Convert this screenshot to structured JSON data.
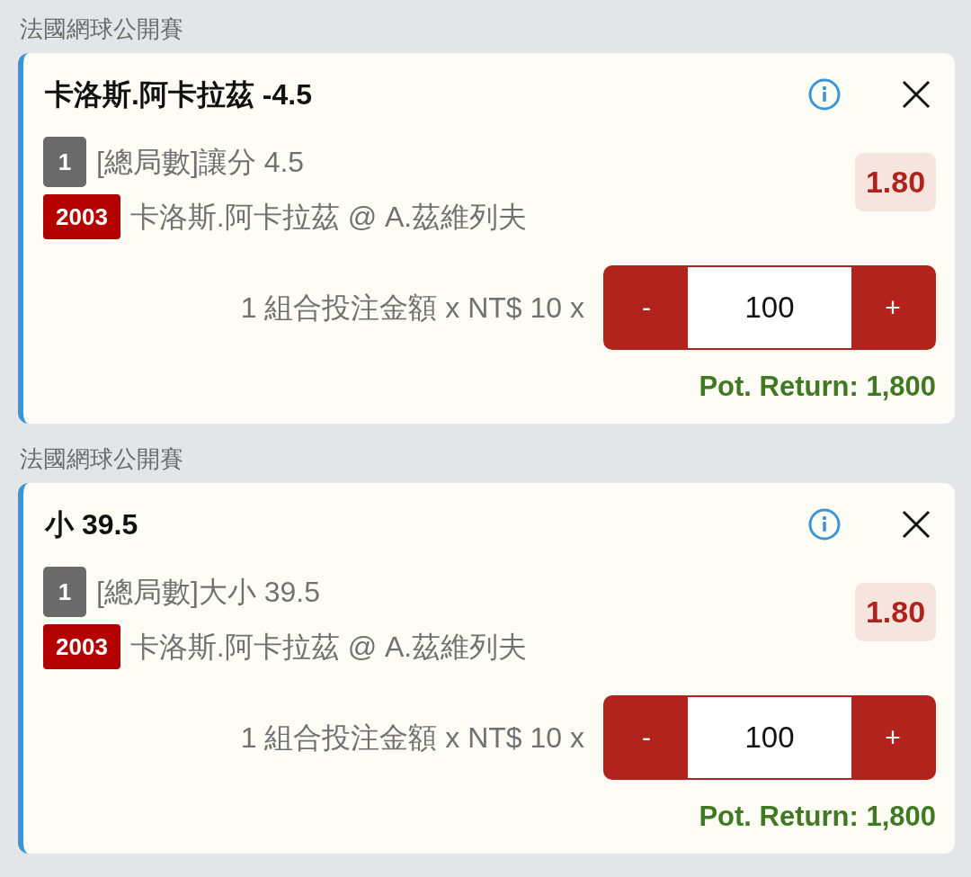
{
  "sections": [
    {
      "league": "法國網球公開賽",
      "bet": {
        "title": "卡洛斯.阿卡拉茲 -4.5",
        "leg_number": "1",
        "market": "[總局數]讓分 4.5",
        "event_code": "2003",
        "match": "卡洛斯.阿卡拉茲 @ A.茲維列夫",
        "odds": "1.80",
        "stake_label": "1 組合投注金額 x NT$ 10 x",
        "stepper": {
          "minus": "-",
          "amount": "100",
          "plus": "+"
        },
        "pot_return": "Pot. Return: 1,800"
      }
    },
    {
      "league": "法國網球公開賽",
      "bet": {
        "title": "小 39.5",
        "leg_number": "1",
        "market": "[總局數]大小 39.5",
        "event_code": "2003",
        "match": "卡洛斯.阿卡拉茲 @ A.茲維列夫",
        "odds": "1.80",
        "stake_label": "1 組合投注金額 x NT$ 10 x",
        "stepper": {
          "minus": "-",
          "amount": "100",
          "plus": "+"
        },
        "pot_return": "Pot. Return: 1,800"
      }
    }
  ]
}
